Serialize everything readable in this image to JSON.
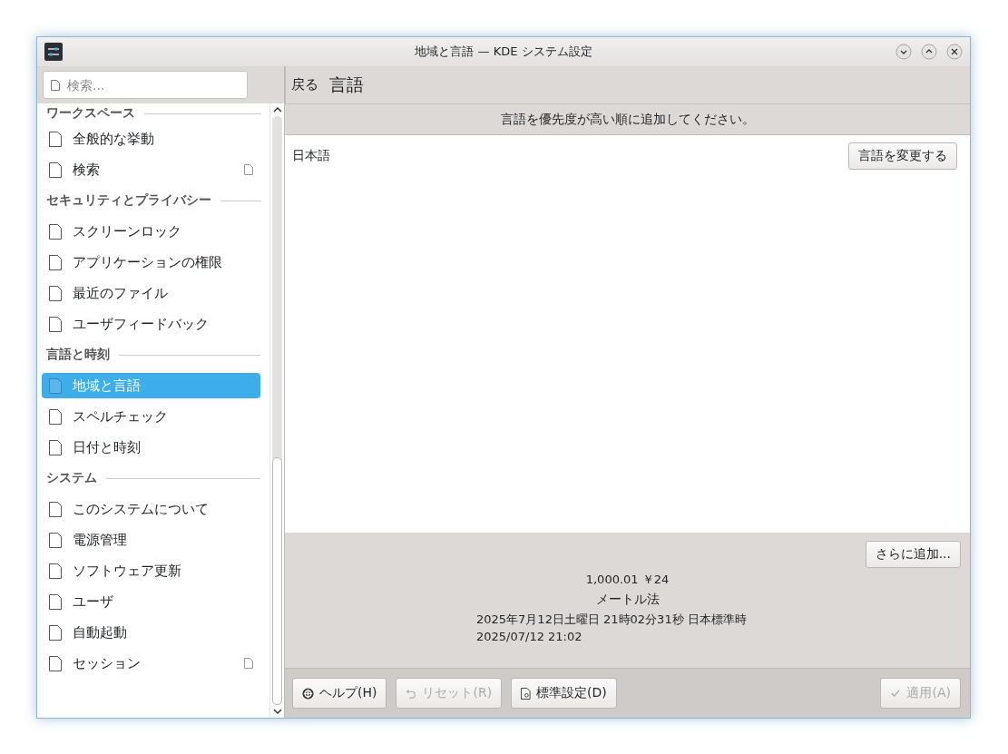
{
  "window": {
    "title": "地域と言語 — KDE システム設定"
  },
  "search": {
    "placeholder": "検索..."
  },
  "sidebar": {
    "sections": [
      {
        "title": "ワークスペース",
        "items": [
          {
            "label": "全般的な挙動",
            "selected": false,
            "badge": false
          },
          {
            "label": "検索",
            "selected": false,
            "badge": true
          }
        ]
      },
      {
        "title": "セキュリティとプライバシー",
        "items": [
          {
            "label": "スクリーンロック",
            "selected": false,
            "badge": false
          },
          {
            "label": "アプリケーションの権限",
            "selected": false,
            "badge": false
          },
          {
            "label": "最近のファイル",
            "selected": false,
            "badge": false
          },
          {
            "label": "ユーザフィードバック",
            "selected": false,
            "badge": false
          }
        ]
      },
      {
        "title": "言語と時刻",
        "items": [
          {
            "label": "地域と言語",
            "selected": true,
            "badge": false
          },
          {
            "label": "スペルチェック",
            "selected": false,
            "badge": false
          },
          {
            "label": "日付と時刻",
            "selected": false,
            "badge": false
          }
        ]
      },
      {
        "title": "システム",
        "items": [
          {
            "label": "このシステムについて",
            "selected": false,
            "badge": false
          },
          {
            "label": "電源管理",
            "selected": false,
            "badge": false
          },
          {
            "label": "ソフトウェア更新",
            "selected": false,
            "badge": false
          },
          {
            "label": "ユーザ",
            "selected": false,
            "badge": false
          },
          {
            "label": "自動起動",
            "selected": false,
            "badge": false
          },
          {
            "label": "セッション",
            "selected": false,
            "badge": true
          }
        ]
      }
    ]
  },
  "page": {
    "back": "戻る",
    "title": "言語",
    "hint": "言語を優先度が高い順に追加してください。",
    "languages": [
      {
        "name": "日本語",
        "button": "言語を変更する"
      }
    ],
    "add_button": "さらに追加...",
    "preview": [
      "1,000.01 ￥24",
      "メートル法",
      "2025年7月12日土曜日 21時02分31秒 日本標準時",
      "2025/07/12 21:02"
    ]
  },
  "footer": {
    "buttons": [
      {
        "kind": "help",
        "label": "ヘルプ(H)",
        "disabled": false
      },
      {
        "kind": "reset",
        "label": "リセット(R)",
        "disabled": true
      },
      {
        "kind": "defaults",
        "label": "標準設定(D)",
        "disabled": false
      },
      {
        "kind": "apply",
        "label": "適用(A)",
        "disabled": true
      }
    ]
  }
}
